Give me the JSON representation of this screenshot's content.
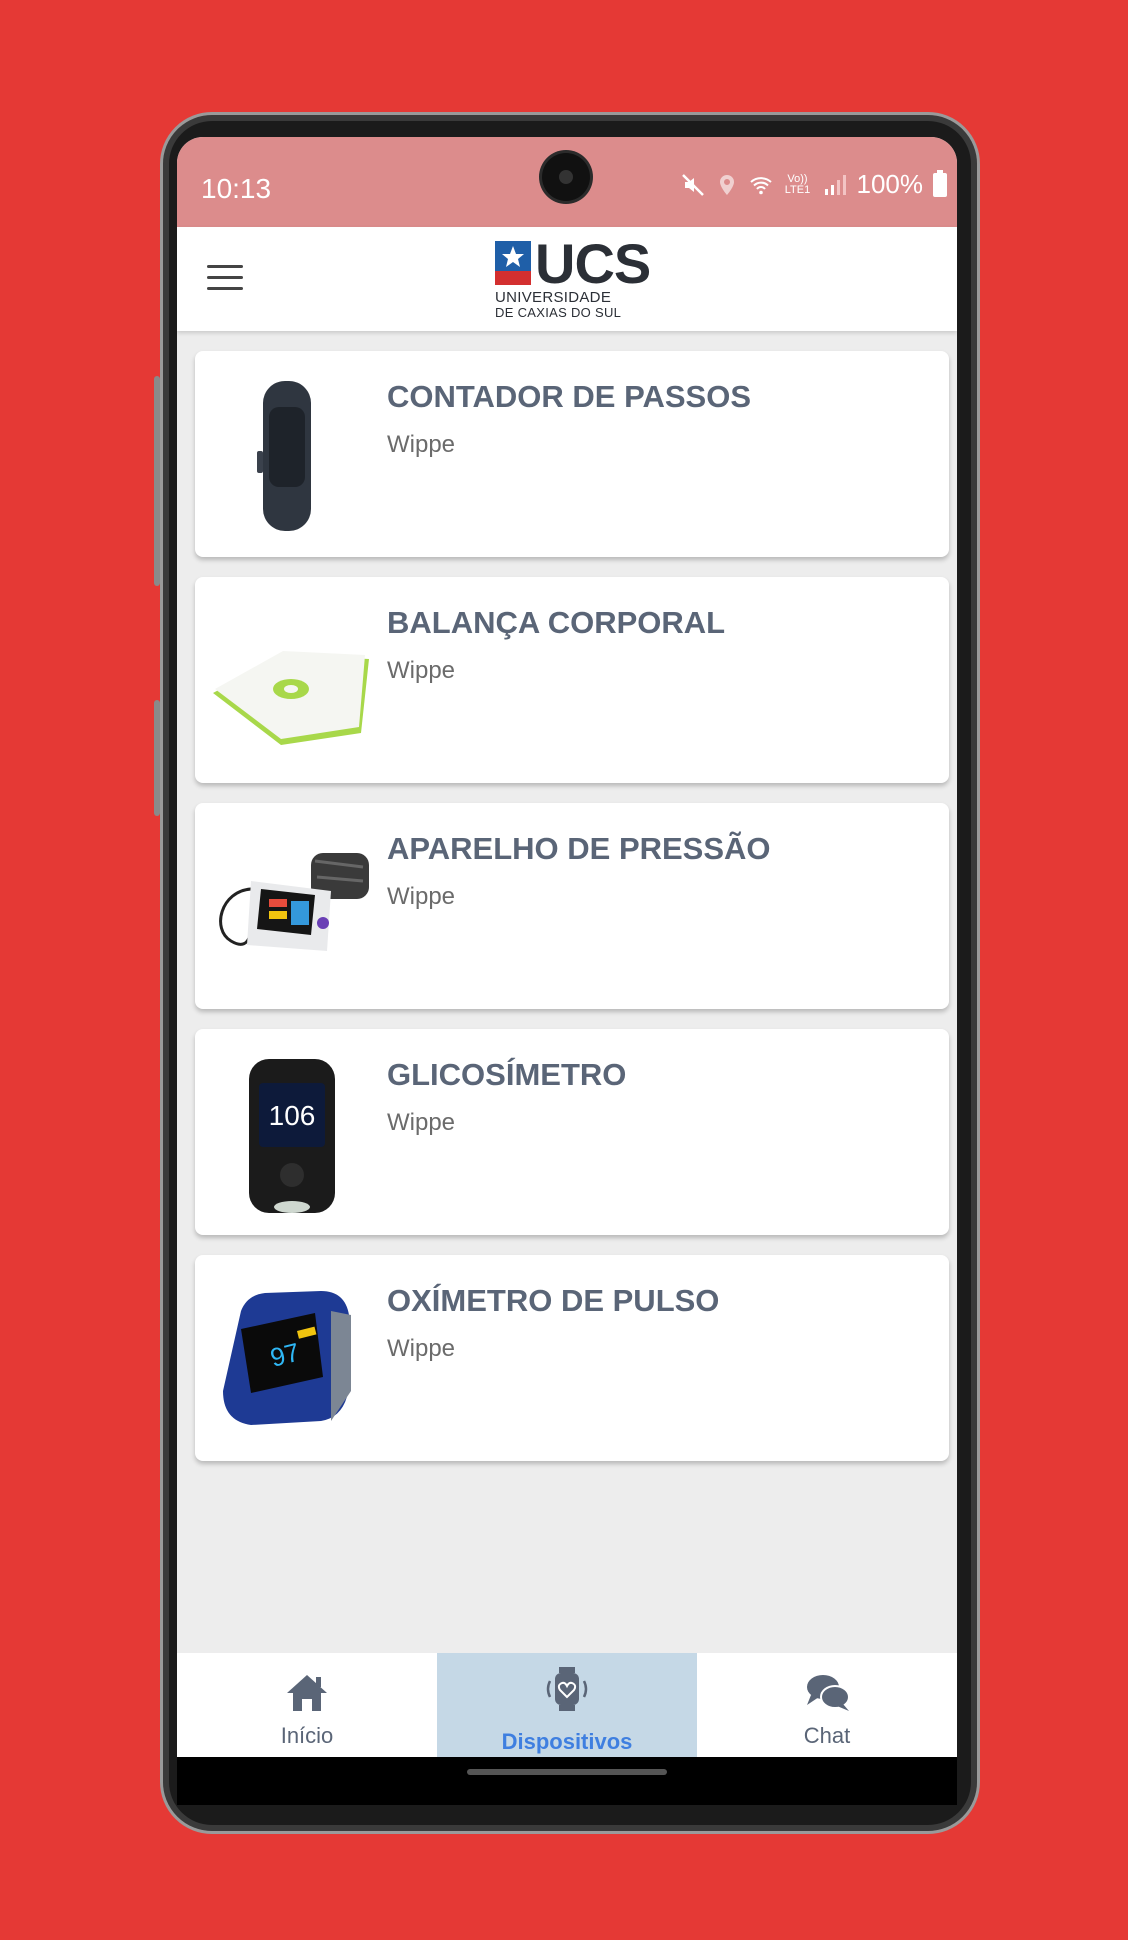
{
  "status": {
    "time": "10:13",
    "battery_text": "100%",
    "lte_text": "Vo)) LTE1"
  },
  "header": {
    "logo_text": "UCS",
    "logo_sub1": "UNIVERSIDADE",
    "logo_sub2": "DE CAXIAS DO SUL"
  },
  "devices": [
    {
      "title": "CONTADOR DE PASSOS",
      "subtitle": "Wippe",
      "icon": "fitness-band-icon"
    },
    {
      "title": "BALANÇA CORPORAL",
      "subtitle": "Wippe",
      "icon": "body-scale-icon"
    },
    {
      "title": "APARELHO DE PRESSÃO",
      "subtitle": "Wippe",
      "icon": "blood-pressure-monitor-icon"
    },
    {
      "title": "GLICOSÍMETRO",
      "subtitle": "Wippe",
      "icon": "glucometer-icon",
      "reading": "106"
    },
    {
      "title": "OXÍMETRO DE PULSO",
      "subtitle": "Wippe",
      "icon": "pulse-oximeter-icon",
      "reading": "97"
    }
  ],
  "tabs": [
    {
      "label": "Início",
      "icon": "home-icon",
      "active": false
    },
    {
      "label": "Dispositivos",
      "icon": "smartwatch-heart-icon",
      "active": true
    },
    {
      "label": "Chat",
      "icon": "chat-bubbles-icon",
      "active": false
    }
  ],
  "colors": {
    "background": "#e53935",
    "statusbar": "#dc8c8c",
    "active_tab_bg": "#c5d8e6",
    "active_tab_text": "#3f7fe0",
    "title_text": "#5a6577"
  }
}
